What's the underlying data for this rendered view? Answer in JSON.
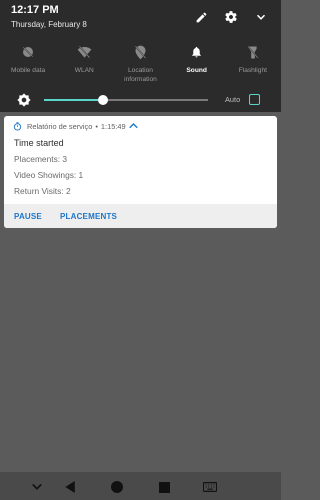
{
  "status": {
    "time": "12:17 PM",
    "date": "Thursday, February 8"
  },
  "top_icons": [
    "edit-icon",
    "settings-icon",
    "collapse-chevron-icon"
  ],
  "tiles": [
    {
      "label": "Mobile data",
      "icon": "mobile-data-off-icon",
      "active": false
    },
    {
      "label": "WLAN",
      "icon": "wlan-off-icon",
      "active": false
    },
    {
      "label": "Location information",
      "icon": "location-off-icon",
      "active": false
    },
    {
      "label": "Sound",
      "icon": "bell-icon",
      "active": true
    },
    {
      "label": "Flashlight",
      "icon": "flashlight-icon",
      "active": false
    }
  ],
  "brightness": {
    "level": 0.36,
    "auto_label": "Auto",
    "auto_checked": false,
    "accent": "#5ad6c9"
  },
  "notification": {
    "app": "Relatório de serviço",
    "separator": "•",
    "elapsed": "1:15:49",
    "title": "Time started",
    "lines": [
      "Placements: 3",
      "Video Showings: 1",
      "Return Visits: 2"
    ],
    "actions": [
      "PAUSE",
      "PLACEMENTS"
    ],
    "accent": "#1d76c9"
  },
  "nav": [
    "chevron-down-icon",
    "back-icon",
    "home-icon",
    "recents-icon",
    "keyboard-icon"
  ]
}
